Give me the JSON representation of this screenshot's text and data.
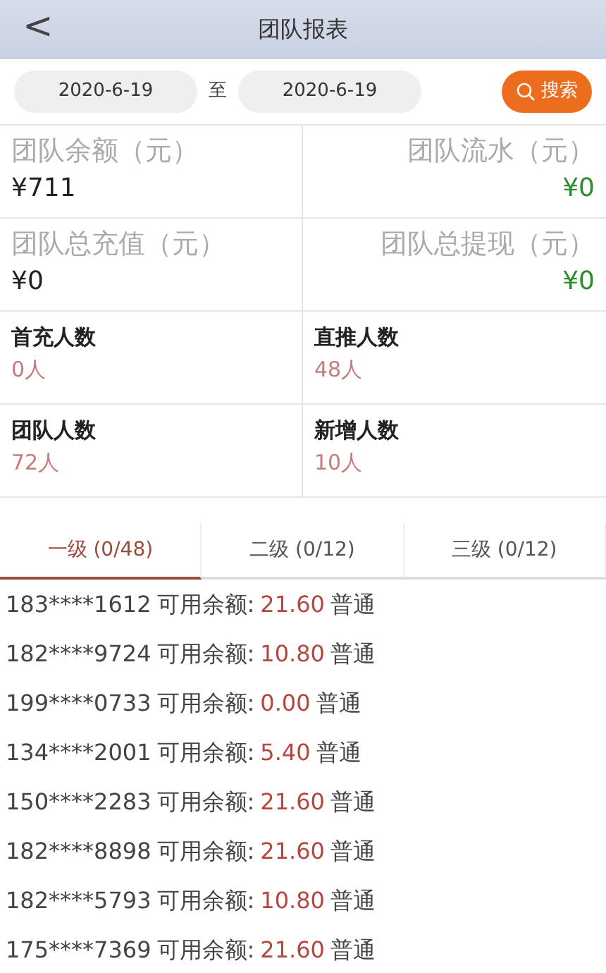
{
  "header": {
    "back": "<",
    "title": "团队报表"
  },
  "filter": {
    "start_date": "2020-6-19",
    "separator": "至",
    "end_date": "2020-6-19",
    "search_button": "搜索"
  },
  "stats": [
    {
      "kind": "money",
      "label": "团队余额（元）",
      "value": "¥711"
    },
    {
      "kind": "money",
      "label": "团队流水（元）",
      "value": "¥0"
    },
    {
      "kind": "money",
      "label": "团队总充值（元）",
      "value": "¥0"
    },
    {
      "kind": "money",
      "label": "团队总提现（元）",
      "value": "¥0"
    },
    {
      "kind": "people",
      "label": "首充人数",
      "value": "0人"
    },
    {
      "kind": "people",
      "label": "直推人数",
      "value": "48人"
    },
    {
      "kind": "people",
      "label": "团队人数",
      "value": "72人"
    },
    {
      "kind": "people",
      "label": "新增人数",
      "value": "10人"
    }
  ],
  "tabs": [
    {
      "label": "一级 (0/48)",
      "selected": true
    },
    {
      "label": "二级 (0/12)",
      "selected": false
    },
    {
      "label": "三级 (0/12)",
      "selected": false
    }
  ],
  "members": [
    {
      "phone": "183****1612",
      "balance_label": "可用余额:",
      "amount": "21.60",
      "level": "普通"
    },
    {
      "phone": "182****9724",
      "balance_label": "可用余额:",
      "amount": "10.80",
      "level": "普通"
    },
    {
      "phone": "199****0733",
      "balance_label": "可用余额:",
      "amount": "0.00",
      "level": "普通"
    },
    {
      "phone": "134****2001",
      "balance_label": "可用余额:",
      "amount": "5.40",
      "level": "普通"
    },
    {
      "phone": "150****2283",
      "balance_label": "可用余额:",
      "amount": "21.60",
      "level": "普通"
    },
    {
      "phone": "182****8898",
      "balance_label": "可用余额:",
      "amount": "21.60",
      "level": "普通"
    },
    {
      "phone": "182****5793",
      "balance_label": "可用余额:",
      "amount": "10.80",
      "level": "普通"
    },
    {
      "phone": "175****7369",
      "balance_label": "可用余额:",
      "amount": "21.60",
      "level": "普通"
    }
  ]
}
